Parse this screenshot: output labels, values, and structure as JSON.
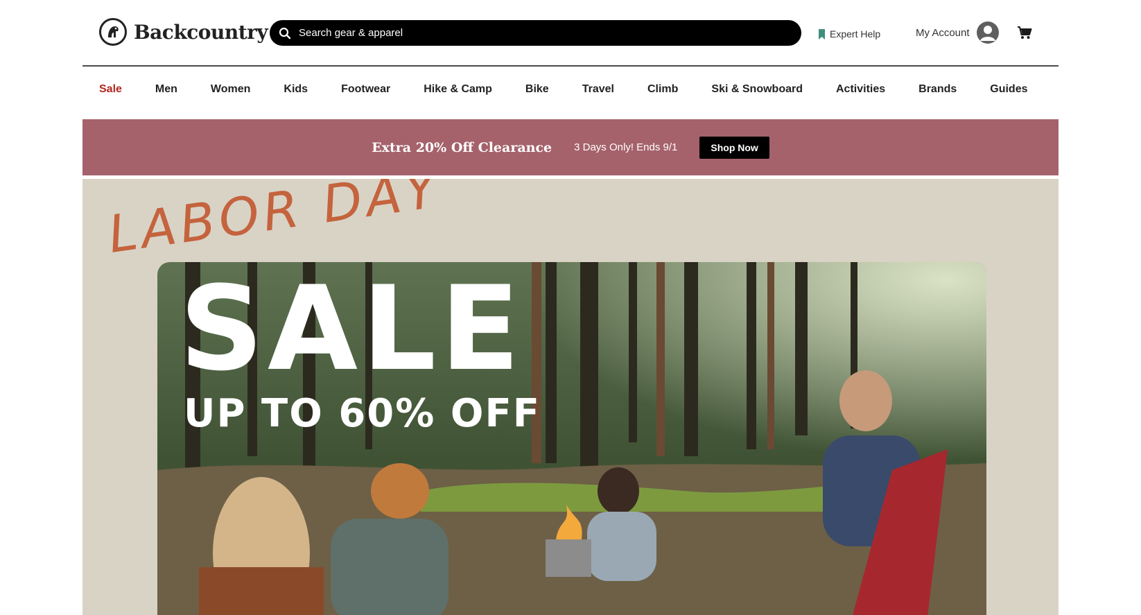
{
  "brand": {
    "name": "Backcountry"
  },
  "search": {
    "placeholder": "Search gear & apparel"
  },
  "header": {
    "expert_help": "Expert Help",
    "my_account": "My Account"
  },
  "nav": {
    "items": [
      {
        "label": "Sale"
      },
      {
        "label": "Men"
      },
      {
        "label": "Women"
      },
      {
        "label": "Kids"
      },
      {
        "label": "Footwear"
      },
      {
        "label": "Hike & Camp"
      },
      {
        "label": "Bike"
      },
      {
        "label": "Travel"
      },
      {
        "label": "Climb"
      },
      {
        "label": "Ski & Snowboard"
      },
      {
        "label": "Activities"
      },
      {
        "label": "Brands"
      },
      {
        "label": "Guides"
      }
    ]
  },
  "promo": {
    "title": "Extra 20% Off Clearance",
    "subtitle": "3 Days Only! Ends 9/1",
    "button": "Shop Now",
    "background_color": "#a5626b"
  },
  "hero": {
    "script_text": "LABOR DAY",
    "headline": "SALE",
    "subheadline": "UP TO 60% OFF"
  },
  "colors": {
    "sale_accent": "#b3261e",
    "expert_icon": "#3f8f7e",
    "hero_script": "#c4633d"
  },
  "icons": {
    "logo": "backcountry-goat-logo-icon",
    "search": "search-icon",
    "expert_help": "bookmark-icon",
    "account": "user-avatar-icon",
    "cart": "cart-icon"
  }
}
